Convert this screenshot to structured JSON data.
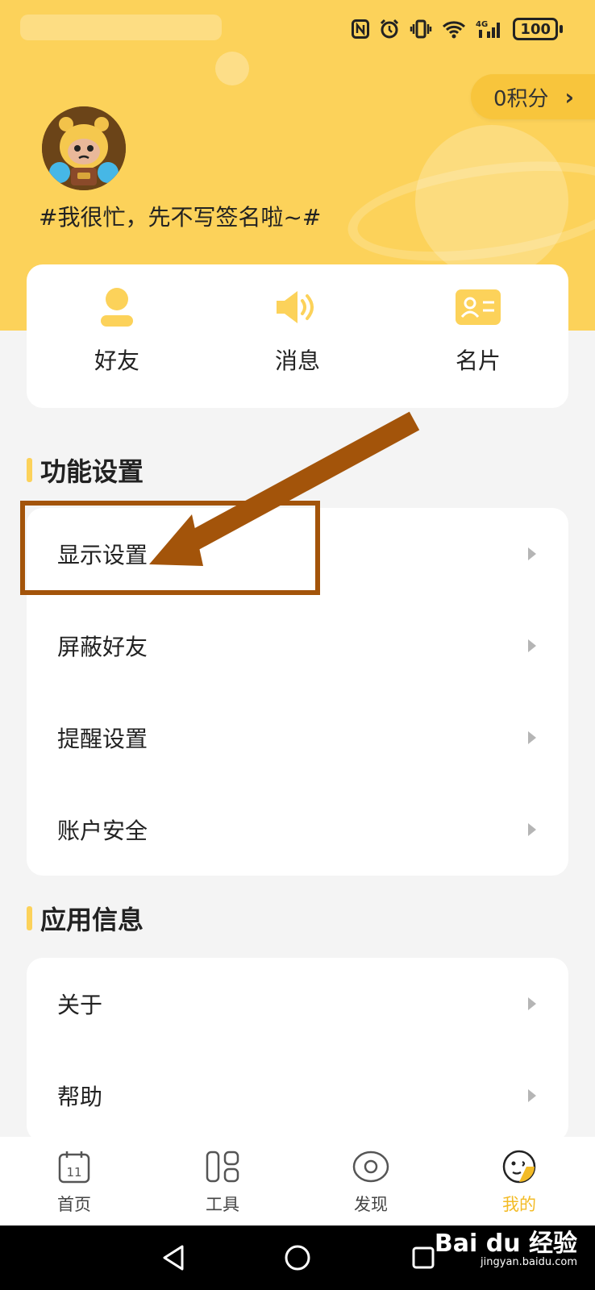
{
  "status_bar": {
    "battery": "100",
    "network": "4G"
  },
  "header": {
    "points_label": "0积分",
    "signature": "#我很忙，先不写签名啦~#",
    "accent_color": "#fcd25a"
  },
  "quick_actions": [
    {
      "label": "好友",
      "icon": "person-icon"
    },
    {
      "label": "消息",
      "icon": "speaker-icon"
    },
    {
      "label": "名片",
      "icon": "id-card-icon"
    }
  ],
  "sections": {
    "function_settings": {
      "title": "功能设置",
      "items": [
        {
          "label": "显示设置"
        },
        {
          "label": "屏蔽好友"
        },
        {
          "label": "提醒设置"
        },
        {
          "label": "账户安全"
        }
      ]
    },
    "app_info": {
      "title": "应用信息",
      "items": [
        {
          "label": "关于"
        },
        {
          "label": "帮助"
        }
      ]
    }
  },
  "bottom_nav": [
    {
      "label": "首页",
      "icon": "calendar-icon",
      "calendar_day": "11"
    },
    {
      "label": "工具",
      "icon": "tools-icon"
    },
    {
      "label": "发现",
      "icon": "eye-icon"
    },
    {
      "label": "我的",
      "icon": "face-icon",
      "active": true
    }
  ],
  "annotation": {
    "color": "#a3540a"
  },
  "watermark": {
    "text": "Bai du 经验",
    "sub": "jingyan.baidu.com"
  }
}
